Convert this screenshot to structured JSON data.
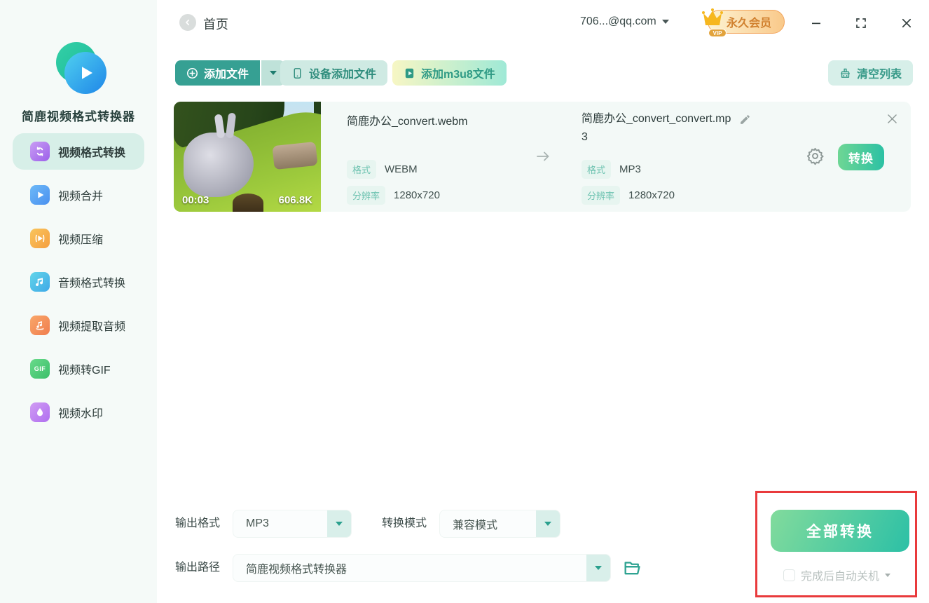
{
  "app": {
    "title": "简鹿视频格式转换器"
  },
  "header": {
    "back_label": "首页",
    "account": "706...@qq.com",
    "vip_label": "永久会员",
    "vip_tag": "VIP"
  },
  "sidebar": {
    "items": [
      {
        "label": "视频格式转换",
        "active": true
      },
      {
        "label": "视频合并"
      },
      {
        "label": "视频压缩"
      },
      {
        "label": "音频格式转换"
      },
      {
        "label": "视频提取音频"
      },
      {
        "label": "视频转GIF"
      },
      {
        "label": "视频水印"
      }
    ]
  },
  "toolbar": {
    "add_file": "添加文件",
    "device_add": "设备添加文件",
    "add_m3u8": "添加m3u8文件",
    "clear_list": "清空列表"
  },
  "file_item": {
    "duration": "00:03",
    "size": "606.8K",
    "source": {
      "name": "简鹿办公_convert.webm",
      "format_label": "格式",
      "format": "WEBM",
      "resolution_label": "分辨率",
      "resolution": "1280x720"
    },
    "target": {
      "name": "简鹿办公_convert_convert.mp3",
      "format_label": "格式",
      "format": "MP3",
      "resolution_label": "分辨率",
      "resolution": "1280x720"
    },
    "convert_button": "转换"
  },
  "footer": {
    "output_format_label": "输出格式",
    "output_format_value": "MP3",
    "convert_mode_label": "转换模式",
    "convert_mode_value": "兼容模式",
    "output_path_label": "输出路径",
    "output_path_value": "简鹿视频格式转换器",
    "convert_all_button": "全部转换",
    "shutdown_label": "完成后自动关机"
  },
  "colors": {
    "accent": "#36a093",
    "accent_light": "#d7efe9",
    "annotation_red": "#e93a3c",
    "vip_orange": "#d1812f"
  }
}
